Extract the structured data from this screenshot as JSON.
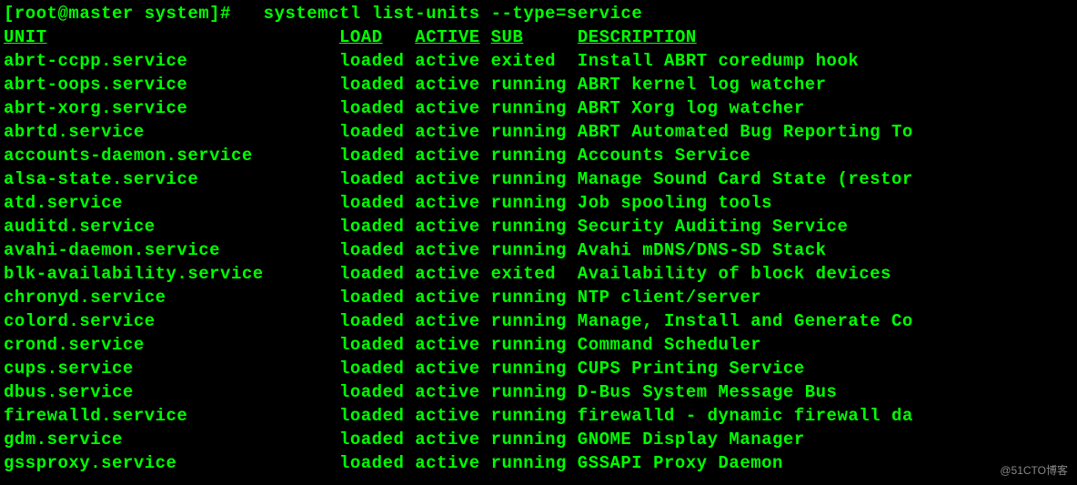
{
  "prompt": {
    "user_host": "[root@master system]#",
    "command": "systemctl list-units --type=service"
  },
  "header": {
    "unit": "UNIT",
    "load": "LOAD",
    "active": "ACTIVE",
    "sub": "SUB",
    "description": "DESCRIPTION"
  },
  "rows": [
    {
      "unit": "abrt-ccpp.service",
      "load": "loaded",
      "active": "active",
      "sub": "exited",
      "description": "Install ABRT coredump hook"
    },
    {
      "unit": "abrt-oops.service",
      "load": "loaded",
      "active": "active",
      "sub": "running",
      "description": "ABRT kernel log watcher"
    },
    {
      "unit": "abrt-xorg.service",
      "load": "loaded",
      "active": "active",
      "sub": "running",
      "description": "ABRT Xorg log watcher"
    },
    {
      "unit": "abrtd.service",
      "load": "loaded",
      "active": "active",
      "sub": "running",
      "description": "ABRT Automated Bug Reporting To"
    },
    {
      "unit": "accounts-daemon.service",
      "load": "loaded",
      "active": "active",
      "sub": "running",
      "description": "Accounts Service"
    },
    {
      "unit": "alsa-state.service",
      "load": "loaded",
      "active": "active",
      "sub": "running",
      "description": "Manage Sound Card State (restor"
    },
    {
      "unit": "atd.service",
      "load": "loaded",
      "active": "active",
      "sub": "running",
      "description": "Job spooling tools"
    },
    {
      "unit": "auditd.service",
      "load": "loaded",
      "active": "active",
      "sub": "running",
      "description": "Security Auditing Service"
    },
    {
      "unit": "avahi-daemon.service",
      "load": "loaded",
      "active": "active",
      "sub": "running",
      "description": "Avahi mDNS/DNS-SD Stack"
    },
    {
      "unit": "blk-availability.service",
      "load": "loaded",
      "active": "active",
      "sub": "exited",
      "description": "Availability of block devices"
    },
    {
      "unit": "chronyd.service",
      "load": "loaded",
      "active": "active",
      "sub": "running",
      "description": "NTP client/server"
    },
    {
      "unit": "colord.service",
      "load": "loaded",
      "active": "active",
      "sub": "running",
      "description": "Manage, Install and Generate Co"
    },
    {
      "unit": "crond.service",
      "load": "loaded",
      "active": "active",
      "sub": "running",
      "description": "Command Scheduler"
    },
    {
      "unit": "cups.service",
      "load": "loaded",
      "active": "active",
      "sub": "running",
      "description": "CUPS Printing Service"
    },
    {
      "unit": "dbus.service",
      "load": "loaded",
      "active": "active",
      "sub": "running",
      "description": "D-Bus System Message Bus"
    },
    {
      "unit": "firewalld.service",
      "load": "loaded",
      "active": "active",
      "sub": "running",
      "description": "firewalld - dynamic firewall da"
    },
    {
      "unit": "gdm.service",
      "load": "loaded",
      "active": "active",
      "sub": "running",
      "description": "GNOME Display Manager"
    },
    {
      "unit": "gssproxy.service",
      "load": "loaded",
      "active": "active",
      "sub": "running",
      "description": "GSSAPI Proxy Daemon"
    }
  ],
  "watermark": "@51CTO博客"
}
